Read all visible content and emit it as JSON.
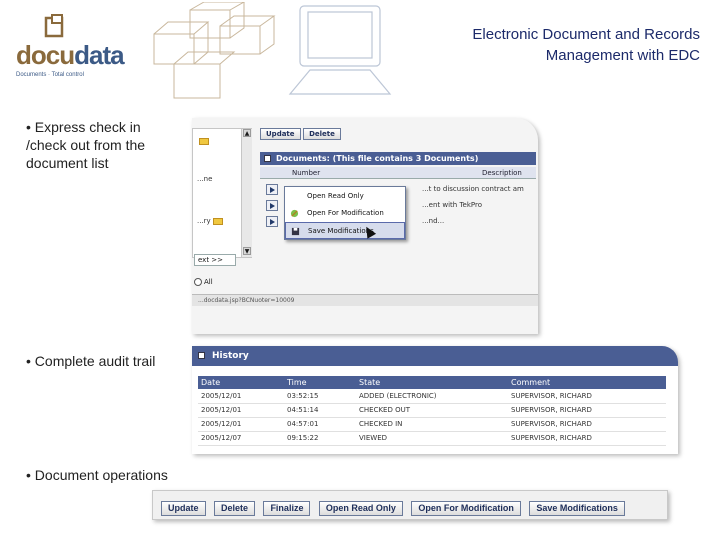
{
  "header": {
    "logo_text_a": "docu",
    "logo_text_b": "data",
    "logo_tagline": "Documents · Total control",
    "title_line1": "Electronic Document and Records",
    "title_line2": "Management with EDC"
  },
  "bullets": [
    "• Express check in /check out from the document list",
    "• Complete audit trail",
    "• Document operations"
  ],
  "list_view": {
    "tree_rows": [
      "",
      "...ne",
      "...ry"
    ],
    "next_label": "ext >>",
    "radio_label": "All",
    "status_url": "...docdata.jsp?BCNuoter=10009",
    "toolbar": [
      "Update",
      "Delete"
    ],
    "panel_title": "Documents: (This file contains 3 Documents)",
    "columns": [
      "Number",
      "Description"
    ],
    "descriptions": [
      "...t to discussion contract am",
      "...ent with TekPro",
      "...nd..."
    ],
    "context_menu": [
      "Open Read Only",
      "Open For Modification",
      "Save Modifications"
    ]
  },
  "history": {
    "title": "History",
    "columns": [
      "Date",
      "Time",
      "State",
      "Comment"
    ],
    "rows": [
      [
        "2005/12/01",
        "03:52:15",
        "ADDED (ELECTRONIC)",
        "SUPERVISOR, RICHARD"
      ],
      [
        "2005/12/01",
        "04:51:14",
        "CHECKED OUT",
        "SUPERVISOR, RICHARD"
      ],
      [
        "2005/12/01",
        "04:57:01",
        "CHECKED IN",
        "SUPERVISOR, RICHARD"
      ],
      [
        "2005/12/07",
        "09:15:22",
        "VIEWED",
        "SUPERVISOR, RICHARD"
      ]
    ]
  },
  "operations": [
    "Update",
    "Delete",
    "Finalize",
    "Open Read Only",
    "Open For Modification",
    "Save Modifications"
  ],
  "colors": {
    "accent": "#4a5e94",
    "title": "#1c2a6a",
    "logo_brown": "#8a6a3c",
    "logo_blue": "#3c5a86"
  }
}
